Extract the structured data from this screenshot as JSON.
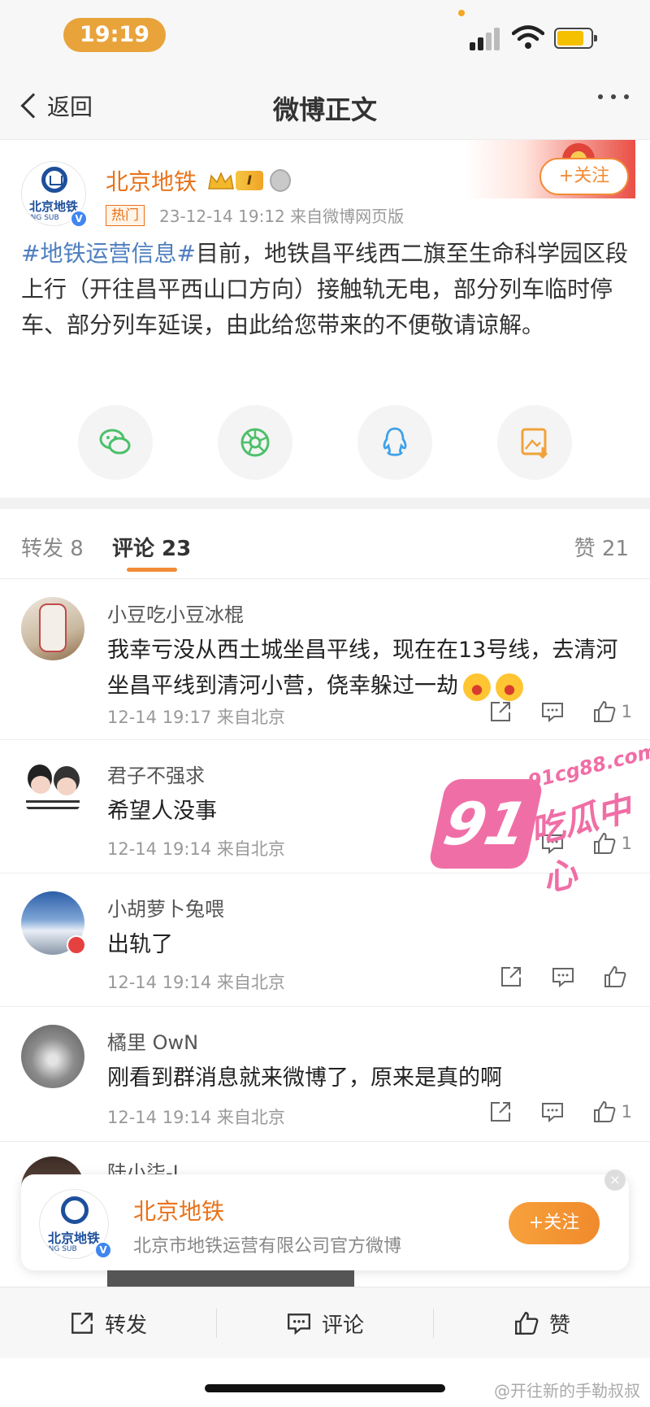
{
  "status_bar": {
    "time": "19:19"
  },
  "nav": {
    "back_label": "返回",
    "title": "微博正文"
  },
  "post": {
    "author": "北京地铁",
    "avatar_text": "北京地铁",
    "avatar_sub": "ING SUB",
    "level": "I",
    "hot_tag": "热门",
    "meta": "23-12-14 19:12  来自微博网页版",
    "follow_label": "+关注",
    "hashtag": "#地铁运营信息#",
    "body": "目前，地铁昌平线西二旗至生命科学园区段上行（开往昌平西山口方向）接触轨无电，部分列车临时停车、部分列车延误，由此给您带来的不便敬请谅解。"
  },
  "share_icons": [
    "wechat-icon",
    "moments-icon",
    "qq-icon",
    "save-image-icon"
  ],
  "tabs": {
    "repost": "转发 8",
    "comments": "评论 23",
    "likes": "赞 21"
  },
  "comments": [
    {
      "name": "小豆吃小豆冰棍",
      "text": "我幸亏没从西土城坐昌平线，现在在13号线，去清河坐昌平线到清河小营，侥幸躲过一劫",
      "meta": "12-14 19:17  来自北京",
      "likes": "1"
    },
    {
      "name": "君子不强求",
      "text": "希望人没事",
      "meta": "12-14 19:14  来自北京",
      "likes": "1"
    },
    {
      "name": "小胡萝卜兔喂",
      "text": "出轨了",
      "meta": "12-14 19:14  来自北京",
      "likes": ""
    },
    {
      "name": "橘里 OwN",
      "text": "刚看到群消息就来微博了，原来是真的啊",
      "meta": "12-14 19:14  来自北京",
      "likes": "1"
    },
    {
      "name": "陆小柒-I"
    }
  ],
  "watermark": {
    "num": "91",
    "url": "91cg88.com",
    "cn": "吃瓜中心"
  },
  "float_card": {
    "name": "北京地铁",
    "desc": "北京市地铁运营有限公司官方微博",
    "follow_label": "+关注",
    "close": "×"
  },
  "bottom_bar": {
    "repost": "转发",
    "comment": "评论",
    "like": "赞"
  },
  "credit": "@开往新的手勒叔叔",
  "colors": {
    "accent": "#f28b36",
    "link": "#4f7fbf",
    "username": "#e8731b"
  }
}
